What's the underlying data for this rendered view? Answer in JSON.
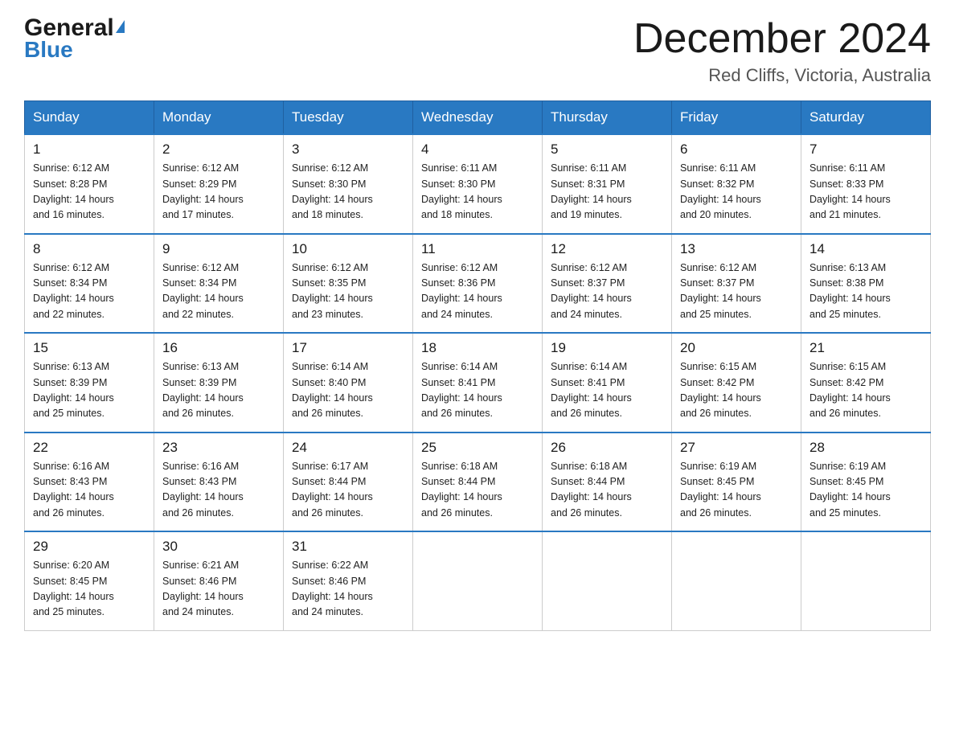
{
  "header": {
    "logo_general": "General",
    "logo_blue": "Blue",
    "month_title": "December 2024",
    "location": "Red Cliffs, Victoria, Australia"
  },
  "days_of_week": [
    "Sunday",
    "Monday",
    "Tuesday",
    "Wednesday",
    "Thursday",
    "Friday",
    "Saturday"
  ],
  "weeks": [
    [
      {
        "day": "1",
        "sunrise": "6:12 AM",
        "sunset": "8:28 PM",
        "daylight": "14 hours and 16 minutes."
      },
      {
        "day": "2",
        "sunrise": "6:12 AM",
        "sunset": "8:29 PM",
        "daylight": "14 hours and 17 minutes."
      },
      {
        "day": "3",
        "sunrise": "6:12 AM",
        "sunset": "8:30 PM",
        "daylight": "14 hours and 18 minutes."
      },
      {
        "day": "4",
        "sunrise": "6:11 AM",
        "sunset": "8:30 PM",
        "daylight": "14 hours and 18 minutes."
      },
      {
        "day": "5",
        "sunrise": "6:11 AM",
        "sunset": "8:31 PM",
        "daylight": "14 hours and 19 minutes."
      },
      {
        "day": "6",
        "sunrise": "6:11 AM",
        "sunset": "8:32 PM",
        "daylight": "14 hours and 20 minutes."
      },
      {
        "day": "7",
        "sunrise": "6:11 AM",
        "sunset": "8:33 PM",
        "daylight": "14 hours and 21 minutes."
      }
    ],
    [
      {
        "day": "8",
        "sunrise": "6:12 AM",
        "sunset": "8:34 PM",
        "daylight": "14 hours and 22 minutes."
      },
      {
        "day": "9",
        "sunrise": "6:12 AM",
        "sunset": "8:34 PM",
        "daylight": "14 hours and 22 minutes."
      },
      {
        "day": "10",
        "sunrise": "6:12 AM",
        "sunset": "8:35 PM",
        "daylight": "14 hours and 23 minutes."
      },
      {
        "day": "11",
        "sunrise": "6:12 AM",
        "sunset": "8:36 PM",
        "daylight": "14 hours and 24 minutes."
      },
      {
        "day": "12",
        "sunrise": "6:12 AM",
        "sunset": "8:37 PM",
        "daylight": "14 hours and 24 minutes."
      },
      {
        "day": "13",
        "sunrise": "6:12 AM",
        "sunset": "8:37 PM",
        "daylight": "14 hours and 25 minutes."
      },
      {
        "day": "14",
        "sunrise": "6:13 AM",
        "sunset": "8:38 PM",
        "daylight": "14 hours and 25 minutes."
      }
    ],
    [
      {
        "day": "15",
        "sunrise": "6:13 AM",
        "sunset": "8:39 PM",
        "daylight": "14 hours and 25 minutes."
      },
      {
        "day": "16",
        "sunrise": "6:13 AM",
        "sunset": "8:39 PM",
        "daylight": "14 hours and 26 minutes."
      },
      {
        "day": "17",
        "sunrise": "6:14 AM",
        "sunset": "8:40 PM",
        "daylight": "14 hours and 26 minutes."
      },
      {
        "day": "18",
        "sunrise": "6:14 AM",
        "sunset": "8:41 PM",
        "daylight": "14 hours and 26 minutes."
      },
      {
        "day": "19",
        "sunrise": "6:14 AM",
        "sunset": "8:41 PM",
        "daylight": "14 hours and 26 minutes."
      },
      {
        "day": "20",
        "sunrise": "6:15 AM",
        "sunset": "8:42 PM",
        "daylight": "14 hours and 26 minutes."
      },
      {
        "day": "21",
        "sunrise": "6:15 AM",
        "sunset": "8:42 PM",
        "daylight": "14 hours and 26 minutes."
      }
    ],
    [
      {
        "day": "22",
        "sunrise": "6:16 AM",
        "sunset": "8:43 PM",
        "daylight": "14 hours and 26 minutes."
      },
      {
        "day": "23",
        "sunrise": "6:16 AM",
        "sunset": "8:43 PM",
        "daylight": "14 hours and 26 minutes."
      },
      {
        "day": "24",
        "sunrise": "6:17 AM",
        "sunset": "8:44 PM",
        "daylight": "14 hours and 26 minutes."
      },
      {
        "day": "25",
        "sunrise": "6:18 AM",
        "sunset": "8:44 PM",
        "daylight": "14 hours and 26 minutes."
      },
      {
        "day": "26",
        "sunrise": "6:18 AM",
        "sunset": "8:44 PM",
        "daylight": "14 hours and 26 minutes."
      },
      {
        "day": "27",
        "sunrise": "6:19 AM",
        "sunset": "8:45 PM",
        "daylight": "14 hours and 26 minutes."
      },
      {
        "day": "28",
        "sunrise": "6:19 AM",
        "sunset": "8:45 PM",
        "daylight": "14 hours and 25 minutes."
      }
    ],
    [
      {
        "day": "29",
        "sunrise": "6:20 AM",
        "sunset": "8:45 PM",
        "daylight": "14 hours and 25 minutes."
      },
      {
        "day": "30",
        "sunrise": "6:21 AM",
        "sunset": "8:46 PM",
        "daylight": "14 hours and 24 minutes."
      },
      {
        "day": "31",
        "sunrise": "6:22 AM",
        "sunset": "8:46 PM",
        "daylight": "14 hours and 24 minutes."
      },
      null,
      null,
      null,
      null
    ]
  ],
  "labels": {
    "sunrise": "Sunrise:",
    "sunset": "Sunset:",
    "daylight": "Daylight:"
  }
}
